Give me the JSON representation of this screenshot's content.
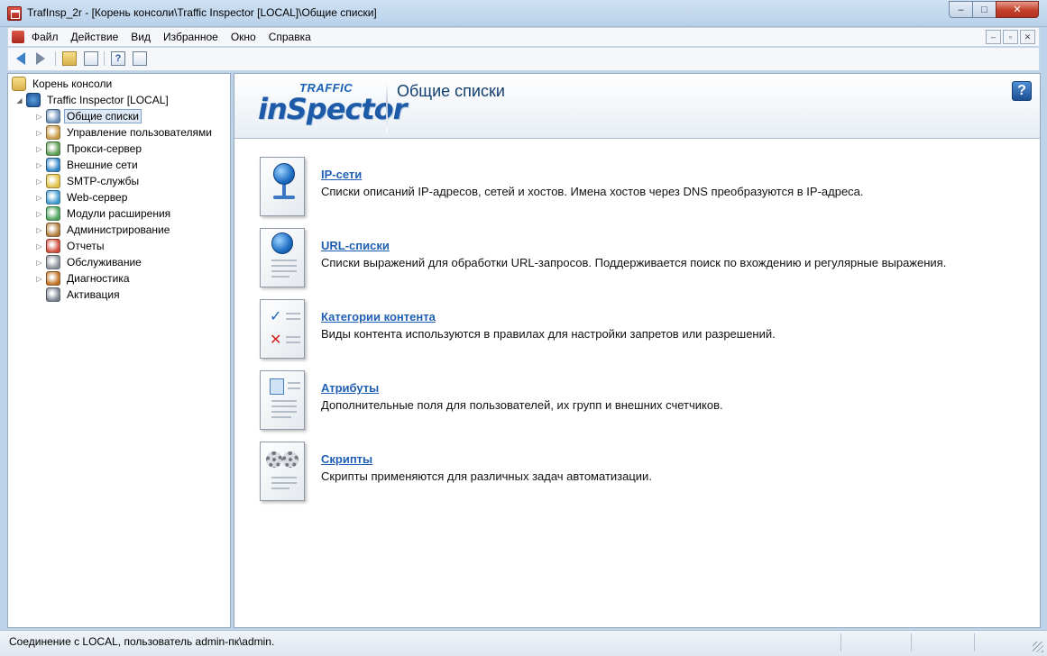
{
  "window": {
    "title": "TrafInsp_2r - [Корень консоли\\Traffic Inspector [LOCAL]\\Общие списки]",
    "minimize": "‒",
    "maximize": "□",
    "close": "✕"
  },
  "menu": {
    "items": [
      "Файл",
      "Действие",
      "Вид",
      "Избранное",
      "Окно",
      "Справка"
    ],
    "mdi": [
      "–",
      "▫",
      "✕"
    ]
  },
  "toolbar": {
    "help_glyph": "?",
    "icons": [
      "back-arrow-icon",
      "forward-arrow-icon",
      "up-folder-icon",
      "console-tree-icon",
      "help-icon",
      "export-list-icon"
    ]
  },
  "tree": {
    "root": "Корень консоли",
    "server": "Traffic Inspector [LOCAL]",
    "items": [
      {
        "label": "Общие списки",
        "selected": true,
        "color": "#6a8fb8"
      },
      {
        "label": "Управление пользователями",
        "color": "#c99a45"
      },
      {
        "label": "Прокси-сервер",
        "color": "#5a9b4f"
      },
      {
        "label": "Внешние сети",
        "color": "#2f86c9"
      },
      {
        "label": "SMTP-службы",
        "color": "#e0c040"
      },
      {
        "label": "Web-сервер",
        "color": "#3f9ad0"
      },
      {
        "label": "Модули расширения",
        "color": "#4aa45b"
      },
      {
        "label": "Администрирование",
        "color": "#b07a3a"
      },
      {
        "label": "Отчеты",
        "color": "#d04a3a"
      },
      {
        "label": "Обслуживание",
        "color": "#8a8f99"
      },
      {
        "label": "Диагностика",
        "color": "#c07020"
      },
      {
        "label": "Активация",
        "color": "#7a8290"
      }
    ]
  },
  "header": {
    "logo_small": "TRAFFIC",
    "logo_big": "inSpector",
    "title": "Общие списки",
    "help": "?"
  },
  "entries": [
    {
      "title": "IP-сети",
      "description": "Списки описаний IP-адресов, сетей и хостов. Имена хостов через DNS преобразуются в IP-адреса.",
      "icon": "network-globe-icon"
    },
    {
      "title": "URL-списки",
      "description": "Списки выражений для обработки URL-запросов. Поддерживается поиск по вхождению и регулярные выражения.",
      "icon": "globe-document-icon"
    },
    {
      "title": "Категории контента",
      "description": "Виды контента используются в правилах для настройки запретов или разрешений.",
      "icon": "checklist-document-icon"
    },
    {
      "title": "Атрибуты",
      "description": "Дополнительные поля для пользователей, их групп и внешних счетчиков.",
      "icon": "user-card-document-icon"
    },
    {
      "title": "Скрипты",
      "description": "Скрипты применяются для различных задач автоматизации.",
      "icon": "gears-document-icon"
    }
  ],
  "entry_glyphs": {
    "check": "✓",
    "cross": "✕"
  },
  "status": {
    "text": "Соединение с LOCAL, пользователь admin-пк\\admin."
  }
}
